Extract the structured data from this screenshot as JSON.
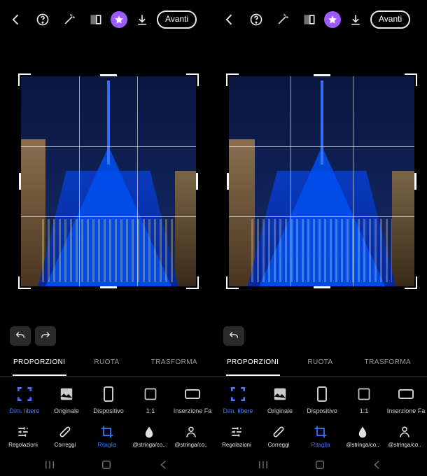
{
  "topbar": {
    "next_label": "Avanti"
  },
  "tabs": {
    "proportions": "PROPORZIONI",
    "rotate": "RUOTA",
    "transform": "TRASFORMA"
  },
  "ratios": {
    "free": "Dim. libere",
    "original": "Originale",
    "device": "Dispositivo",
    "square": "1:1",
    "fbad": "Inserzione Fa"
  },
  "tools": {
    "adjustments": "Regolazioni",
    "correct": "Correggi",
    "crop": "Ritaglia",
    "string1": "@stringa/co..",
    "string2": "@stringa/co.."
  }
}
